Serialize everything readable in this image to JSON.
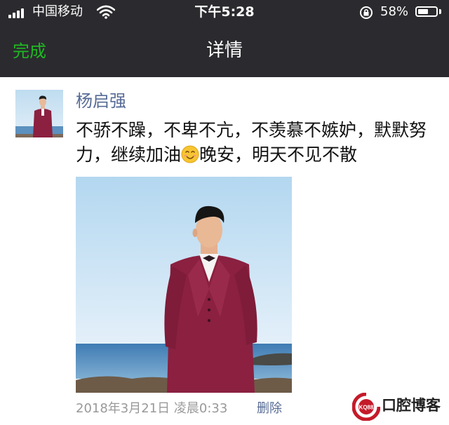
{
  "status_bar": {
    "carrier": "中国移动",
    "time": "下午5:28",
    "battery": "58%",
    "battery_level": 0.58
  },
  "nav": {
    "done_label": "完成",
    "title": "详情"
  },
  "post": {
    "author": "杨启强",
    "text_before_emoji": "不骄不躁，不卑不亢，不羡慕不嫉妒，默默努力，继续加油",
    "emoji_icon": "smiling-face-icon",
    "text_after_emoji": "晚安，明天不见不散",
    "date": "2018年3月21日 凌晨0:33",
    "delete_label": "删除"
  },
  "watermark": {
    "badge": "KQ88",
    "text": "口腔博客"
  }
}
